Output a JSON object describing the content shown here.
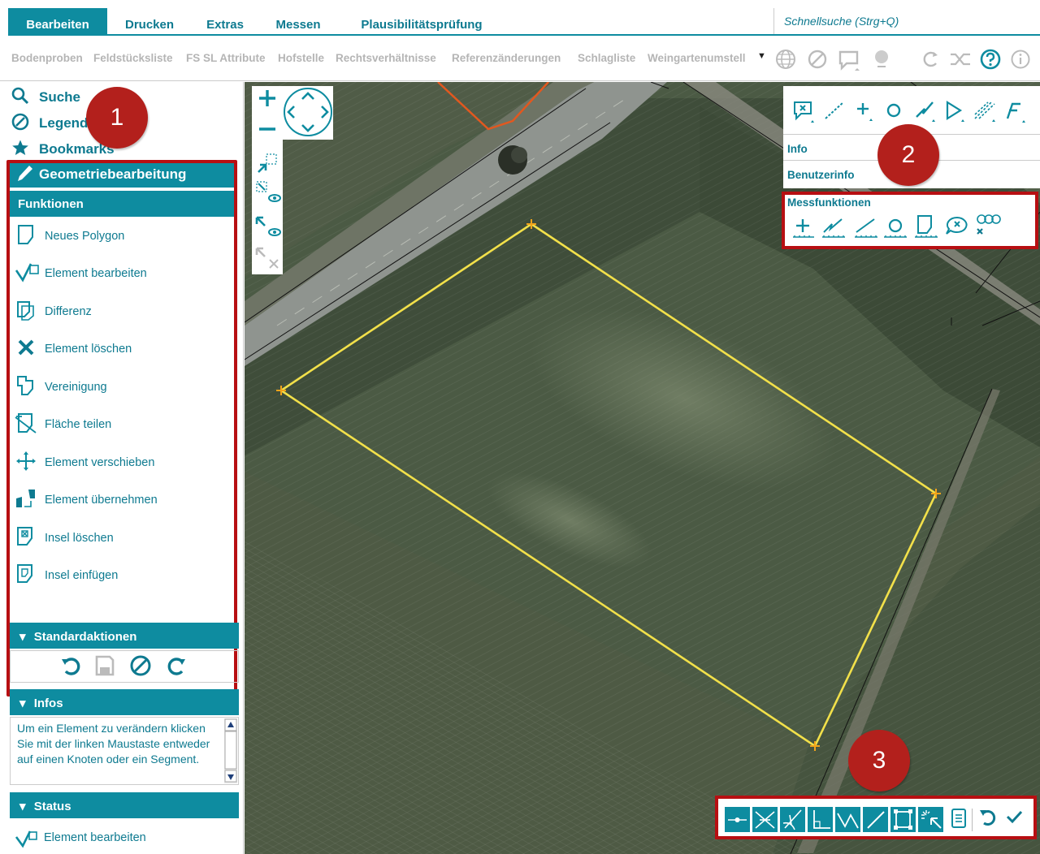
{
  "menu": {
    "tabs": [
      {
        "label": "Bearbeiten",
        "active": true
      },
      {
        "label": "Drucken"
      },
      {
        "label": "Extras"
      },
      {
        "label": "Messen"
      },
      {
        "label": "Plausibilitätsprüfung"
      }
    ],
    "quicksearch_placeholder": "Schnellsuche (Strg+Q)"
  },
  "subtoolbar": {
    "items": [
      "Bodenproben",
      "Feldstücksliste",
      "FS SL Attribute",
      "Hofstelle",
      "Rechtsverhältnisse",
      "Referenzänderungen",
      "Schlagliste",
      "Weingartenumstell"
    ],
    "overflow_arrow": "▼",
    "icons": [
      "globe-icon",
      "block-icon",
      "comment-icon",
      "map-pin-icon",
      "redo-icon",
      "shuffle-icon",
      "help-icon",
      "info-icon"
    ]
  },
  "sidebar": {
    "accordion": [
      {
        "icon": "search-icon",
        "label": "Suche"
      },
      {
        "icon": "compass-icon",
        "label": "Legende"
      },
      {
        "icon": "star-icon",
        "label": "Bookmarks"
      }
    ],
    "geometry_title": "Geometriebearbeitung",
    "functions_title": "Funktionen",
    "functions": [
      {
        "icon": "new-polygon-icon",
        "label": "Neues Polygon"
      },
      {
        "icon": "edit-element-icon",
        "label": "Element bearbeiten"
      },
      {
        "icon": "difference-icon",
        "label": "Differenz"
      },
      {
        "icon": "delete-element-icon",
        "label": "Element löschen"
      },
      {
        "icon": "union-icon",
        "label": "Vereinigung"
      },
      {
        "icon": "split-area-icon",
        "label": "Fläche teilen"
      },
      {
        "icon": "move-element-icon",
        "label": "Element verschieben"
      },
      {
        "icon": "adopt-element-icon",
        "label": "Element übernehmen"
      },
      {
        "icon": "delete-island-icon",
        "label": "Insel löschen"
      },
      {
        "icon": "insert-island-icon",
        "label": "Insel einfügen"
      }
    ],
    "standard_actions_title": "Standardaktionen",
    "infos_title": "Infos",
    "info_text": "Um ein Element zu verändern klicken Sie mit der linken Maustaste entweder auf einen Knoten oder ein Segment.",
    "status_title": "Status",
    "status_text": "Element bearbeiten",
    "section_arrow": "▾"
  },
  "right_panel": {
    "info_label": "Info",
    "userinfo_label": "Benutzerinfo",
    "mess_label": "Messfunktionen"
  },
  "badges": [
    "1",
    "2",
    "3"
  ],
  "colors": {
    "accent": "#0e8ca0",
    "highlight_box": "#b70f12",
    "badge": "#b3201c",
    "polygon": "#f2e04a",
    "parcel_line": "#e2581f"
  }
}
